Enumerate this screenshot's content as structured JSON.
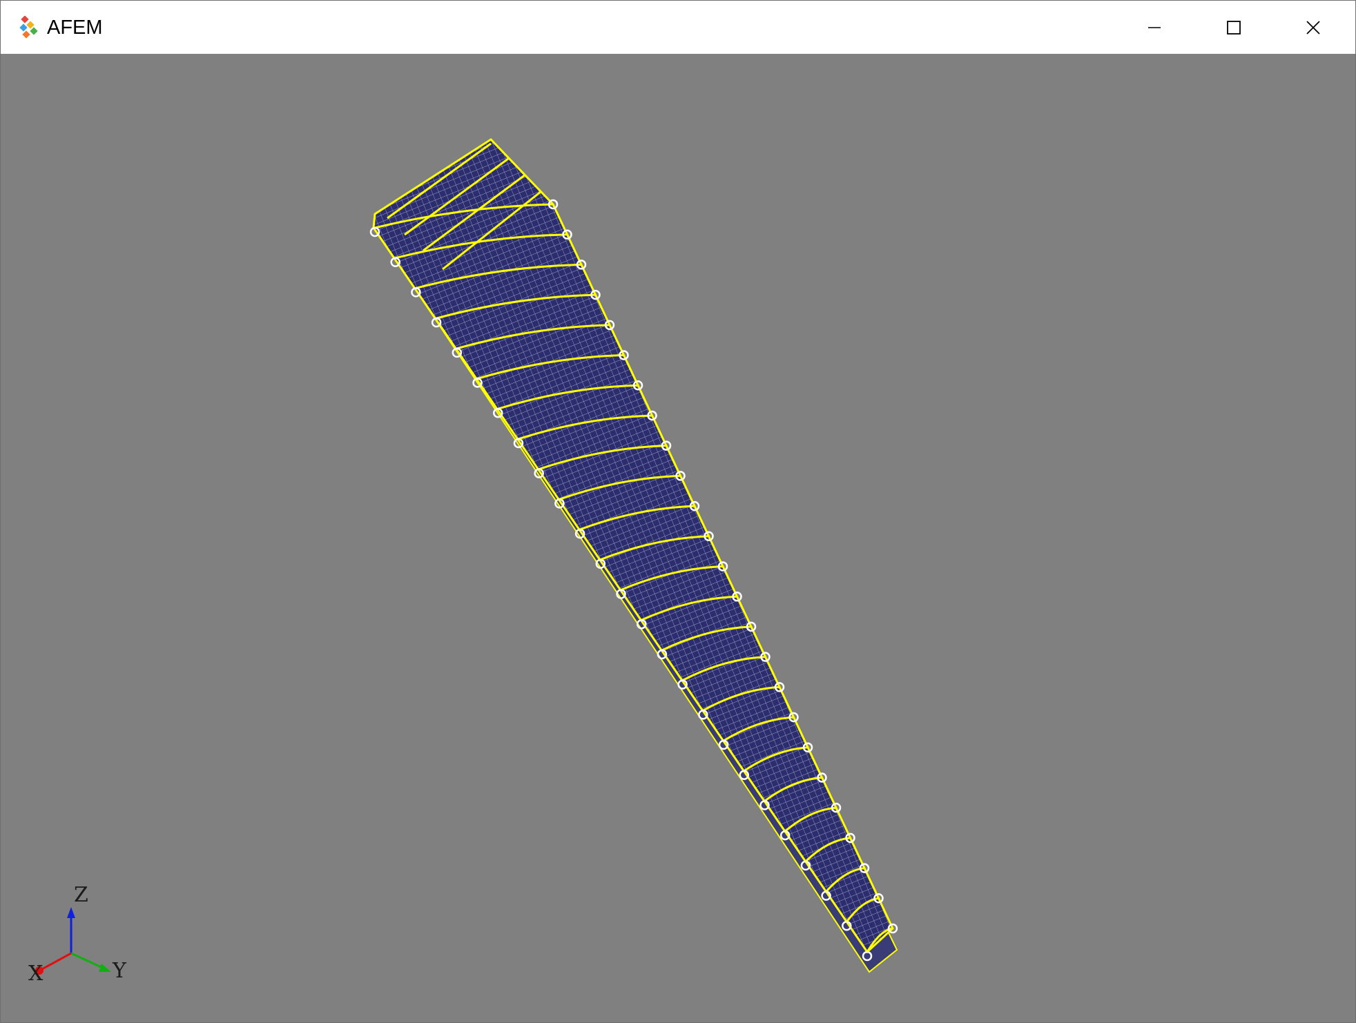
{
  "window": {
    "title": "AFEM"
  },
  "titlebar_icons": {
    "app": "afem-logo-icon",
    "minimize": "minimize-icon",
    "maximize": "maximize-icon",
    "close": "close-icon"
  },
  "viewport": {
    "background": "#808080",
    "mesh_fill": "#2b2d6e",
    "mesh_grid": "#c9cbe6",
    "edge_color": "#ffff00",
    "node_color": "#ffffff",
    "rib_count": 24
  },
  "triad": {
    "x_label": "X",
    "y_label": "Y",
    "z_label": "Z",
    "x_color": "#e01010",
    "y_color": "#10b010",
    "z_color": "#1020e0"
  }
}
